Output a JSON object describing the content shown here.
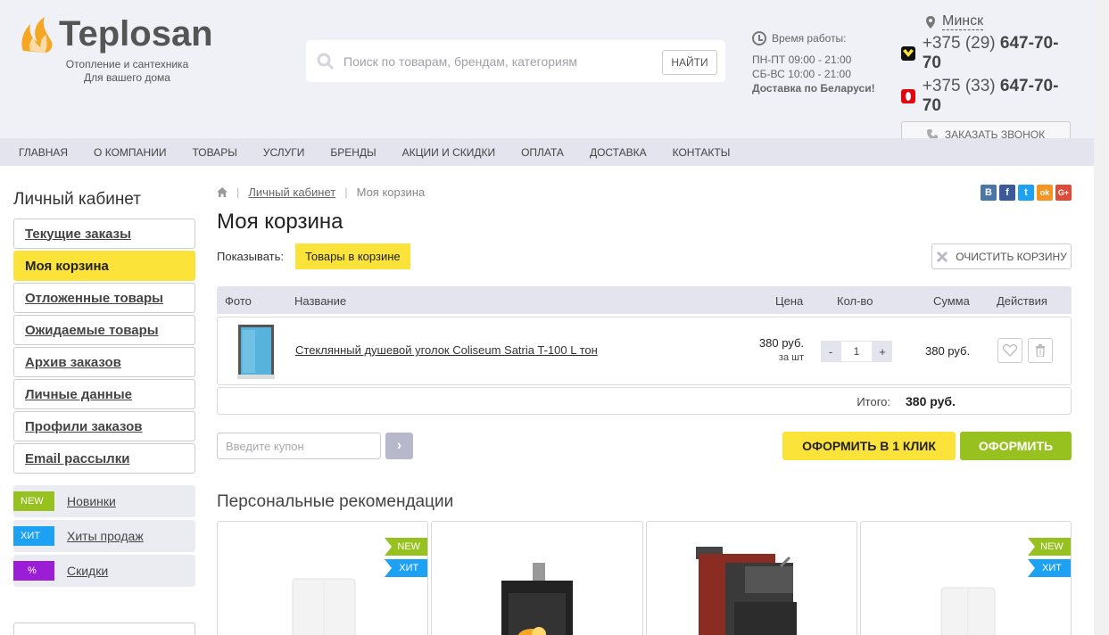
{
  "header": {
    "logo_text": "Teplosan",
    "tagline_1": "Отопление и сантехника",
    "tagline_2": "Для вашего дома",
    "search_placeholder": "Поиск по товарам, брендам, категориям",
    "search_button": "НАЙТИ",
    "hours_title": "Время работы:",
    "hours_weekdays": "ПН-ПТ 09:00 - 21:00",
    "hours_weekend": "СБ-ВС 10:00 - 21:00",
    "delivery": "Доставка по Беларуси!",
    "city": "Минск",
    "phone_1_prefix": "+375 (29)",
    "phone_1_number": "647-70-70",
    "phone_2_prefix": "+375 (33)",
    "phone_2_number": "647-70-70",
    "callback_button": "ЗАКАЗАТЬ ЗВОНОК"
  },
  "nav": {
    "items": [
      "ГЛАВНАЯ",
      "О КОМПАНИИ",
      "ТОВАРЫ",
      "УСЛУГИ",
      "БРЕНДЫ",
      "АКЦИИ И СКИДКИ",
      "ОПЛАТА",
      "ДОСТАВКА",
      "КОНТАКТЫ"
    ]
  },
  "sidebar": {
    "title": "Личный кабинет",
    "items": [
      {
        "label": "Текущие заказы",
        "active": false
      },
      {
        "label": "Моя корзина",
        "active": true
      },
      {
        "label": "Отложенные товары",
        "active": false
      },
      {
        "label": "Ожидаемые товары",
        "active": false
      },
      {
        "label": "Архив заказов",
        "active": false
      },
      {
        "label": "Личные данные",
        "active": false
      },
      {
        "label": "Профили заказов",
        "active": false
      },
      {
        "label": "Email рассылки",
        "active": false
      }
    ],
    "tags": [
      {
        "badge": "NEW",
        "label": "Новинки",
        "color": "#96c11f"
      },
      {
        "badge": "ХИТ",
        "label": "Хиты продаж",
        "color": "#1da1f2"
      },
      {
        "badge": "%",
        "label": "Скидки",
        "color": "#9b1dd6"
      }
    ]
  },
  "breadcrumb": {
    "home_icon": "home-icon",
    "items": [
      "Личный кабинет",
      "Моя корзина"
    ]
  },
  "share": [
    {
      "label": "B",
      "color": "#4a76a8"
    },
    {
      "label": "f",
      "color": "#3b5998"
    },
    {
      "label": "t",
      "color": "#1da1f2"
    },
    {
      "label": "ok",
      "color": "#f59422"
    },
    {
      "label": "G+",
      "color": "#dd4b39"
    }
  ],
  "page": {
    "title": "Моя корзина",
    "show_label": "Показывать:",
    "show_chip": "Товары в корзине",
    "clear_button": "ОЧИСТИТЬ КОРЗИНУ"
  },
  "table": {
    "headers": {
      "photo": "Фото",
      "name": "Название",
      "price": "Цена",
      "qty": "Кол-во",
      "sum": "Сумма",
      "actions": "Действия"
    },
    "rows": [
      {
        "name": "Стеклянный душевой уголок Coliseum Satria T-100 L тон",
        "price": "380 руб.",
        "price_unit": "за шт",
        "qty": "1",
        "sum": "380 руб."
      }
    ],
    "total_label": "Итого:",
    "total_value": "380 руб."
  },
  "checkout": {
    "coupon_placeholder": "Введите купон",
    "coupon_go": "›",
    "one_click": "ОФОРМИТЬ В 1 КЛИК",
    "order": "ОФОРМИТЬ"
  },
  "recommendations": {
    "title": "Персональные рекомендации",
    "cards": [
      {
        "flags": [
          "NEW",
          "ХИТ"
        ],
        "product": "boiler"
      },
      {
        "flags": [],
        "product": "stove"
      },
      {
        "flags": [],
        "product": "boiler-red"
      },
      {
        "flags": [
          "NEW",
          "ХИТ"
        ],
        "product": "boiler"
      }
    ]
  },
  "colors": {
    "accent_yellow": "#fce33a",
    "accent_green": "#96c11f",
    "new_flag": "#96c11f",
    "hit_flag": "#1da1f2"
  },
  "qty_minus": "-",
  "qty_plus": "+"
}
